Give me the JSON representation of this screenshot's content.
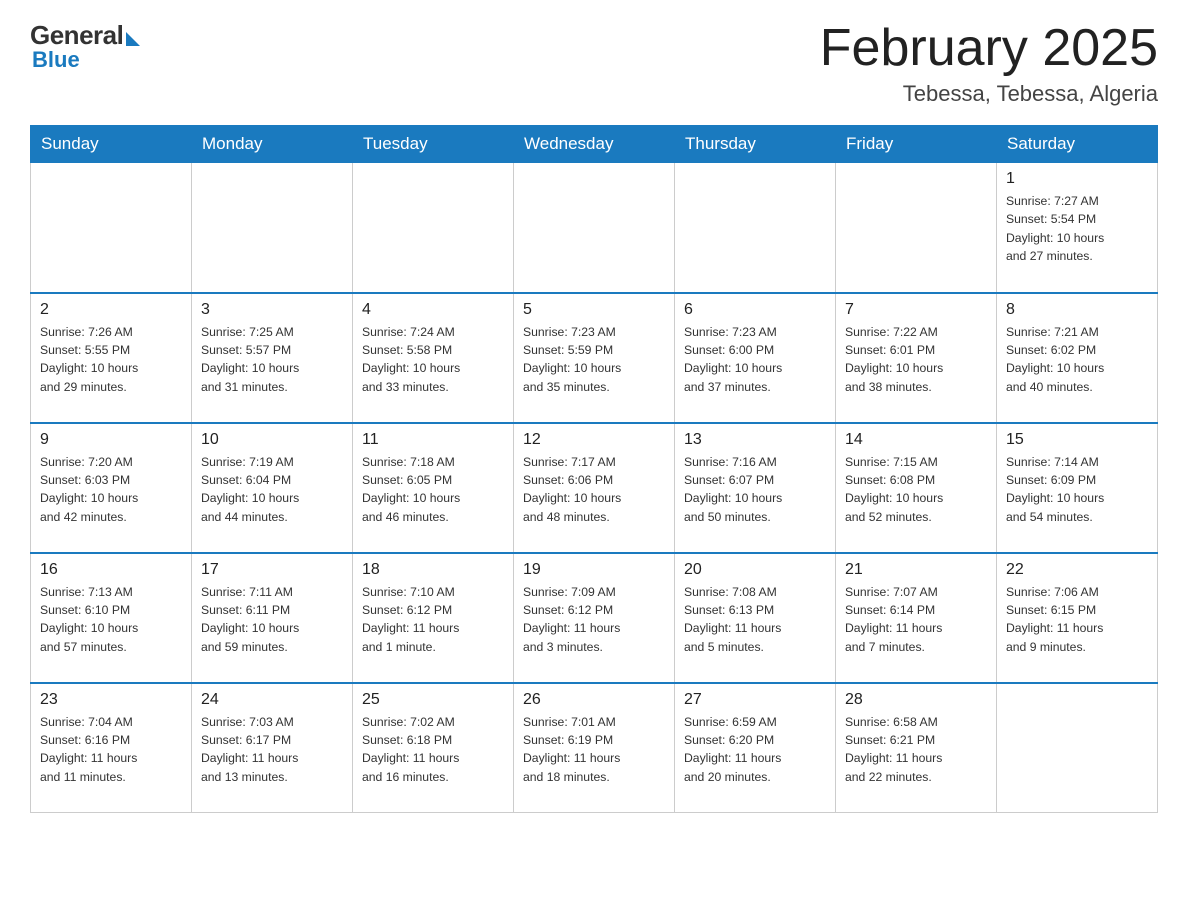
{
  "header": {
    "logo": {
      "general": "General",
      "blue": "Blue"
    },
    "title": "February 2025",
    "location": "Tebessa, Tebessa, Algeria"
  },
  "weekdays": [
    "Sunday",
    "Monday",
    "Tuesday",
    "Wednesday",
    "Thursday",
    "Friday",
    "Saturday"
  ],
  "weeks": [
    [
      {
        "day": "",
        "info": ""
      },
      {
        "day": "",
        "info": ""
      },
      {
        "day": "",
        "info": ""
      },
      {
        "day": "",
        "info": ""
      },
      {
        "day": "",
        "info": ""
      },
      {
        "day": "",
        "info": ""
      },
      {
        "day": "1",
        "info": "Sunrise: 7:27 AM\nSunset: 5:54 PM\nDaylight: 10 hours\nand 27 minutes."
      }
    ],
    [
      {
        "day": "2",
        "info": "Sunrise: 7:26 AM\nSunset: 5:55 PM\nDaylight: 10 hours\nand 29 minutes."
      },
      {
        "day": "3",
        "info": "Sunrise: 7:25 AM\nSunset: 5:57 PM\nDaylight: 10 hours\nand 31 minutes."
      },
      {
        "day": "4",
        "info": "Sunrise: 7:24 AM\nSunset: 5:58 PM\nDaylight: 10 hours\nand 33 minutes."
      },
      {
        "day": "5",
        "info": "Sunrise: 7:23 AM\nSunset: 5:59 PM\nDaylight: 10 hours\nand 35 minutes."
      },
      {
        "day": "6",
        "info": "Sunrise: 7:23 AM\nSunset: 6:00 PM\nDaylight: 10 hours\nand 37 minutes."
      },
      {
        "day": "7",
        "info": "Sunrise: 7:22 AM\nSunset: 6:01 PM\nDaylight: 10 hours\nand 38 minutes."
      },
      {
        "day": "8",
        "info": "Sunrise: 7:21 AM\nSunset: 6:02 PM\nDaylight: 10 hours\nand 40 minutes."
      }
    ],
    [
      {
        "day": "9",
        "info": "Sunrise: 7:20 AM\nSunset: 6:03 PM\nDaylight: 10 hours\nand 42 minutes."
      },
      {
        "day": "10",
        "info": "Sunrise: 7:19 AM\nSunset: 6:04 PM\nDaylight: 10 hours\nand 44 minutes."
      },
      {
        "day": "11",
        "info": "Sunrise: 7:18 AM\nSunset: 6:05 PM\nDaylight: 10 hours\nand 46 minutes."
      },
      {
        "day": "12",
        "info": "Sunrise: 7:17 AM\nSunset: 6:06 PM\nDaylight: 10 hours\nand 48 minutes."
      },
      {
        "day": "13",
        "info": "Sunrise: 7:16 AM\nSunset: 6:07 PM\nDaylight: 10 hours\nand 50 minutes."
      },
      {
        "day": "14",
        "info": "Sunrise: 7:15 AM\nSunset: 6:08 PM\nDaylight: 10 hours\nand 52 minutes."
      },
      {
        "day": "15",
        "info": "Sunrise: 7:14 AM\nSunset: 6:09 PM\nDaylight: 10 hours\nand 54 minutes."
      }
    ],
    [
      {
        "day": "16",
        "info": "Sunrise: 7:13 AM\nSunset: 6:10 PM\nDaylight: 10 hours\nand 57 minutes."
      },
      {
        "day": "17",
        "info": "Sunrise: 7:11 AM\nSunset: 6:11 PM\nDaylight: 10 hours\nand 59 minutes."
      },
      {
        "day": "18",
        "info": "Sunrise: 7:10 AM\nSunset: 6:12 PM\nDaylight: 11 hours\nand 1 minute."
      },
      {
        "day": "19",
        "info": "Sunrise: 7:09 AM\nSunset: 6:12 PM\nDaylight: 11 hours\nand 3 minutes."
      },
      {
        "day": "20",
        "info": "Sunrise: 7:08 AM\nSunset: 6:13 PM\nDaylight: 11 hours\nand 5 minutes."
      },
      {
        "day": "21",
        "info": "Sunrise: 7:07 AM\nSunset: 6:14 PM\nDaylight: 11 hours\nand 7 minutes."
      },
      {
        "day": "22",
        "info": "Sunrise: 7:06 AM\nSunset: 6:15 PM\nDaylight: 11 hours\nand 9 minutes."
      }
    ],
    [
      {
        "day": "23",
        "info": "Sunrise: 7:04 AM\nSunset: 6:16 PM\nDaylight: 11 hours\nand 11 minutes."
      },
      {
        "day": "24",
        "info": "Sunrise: 7:03 AM\nSunset: 6:17 PM\nDaylight: 11 hours\nand 13 minutes."
      },
      {
        "day": "25",
        "info": "Sunrise: 7:02 AM\nSunset: 6:18 PM\nDaylight: 11 hours\nand 16 minutes."
      },
      {
        "day": "26",
        "info": "Sunrise: 7:01 AM\nSunset: 6:19 PM\nDaylight: 11 hours\nand 18 minutes."
      },
      {
        "day": "27",
        "info": "Sunrise: 6:59 AM\nSunset: 6:20 PM\nDaylight: 11 hours\nand 20 minutes."
      },
      {
        "day": "28",
        "info": "Sunrise: 6:58 AM\nSunset: 6:21 PM\nDaylight: 11 hours\nand 22 minutes."
      },
      {
        "day": "",
        "info": ""
      }
    ]
  ]
}
